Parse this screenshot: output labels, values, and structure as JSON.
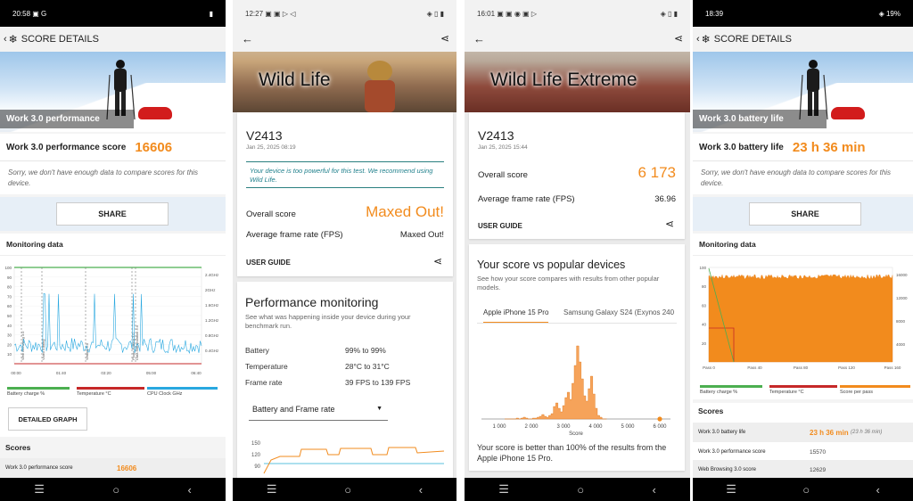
{
  "colors": {
    "accent": "#f28b1d",
    "green": "#4caf50",
    "red": "#c62828",
    "blue": "#29a8e0"
  },
  "panel1": {
    "status": {
      "time": "20:58",
      "icons": "▣ G",
      "battery": "▮"
    },
    "appbar_title": "SCORE DETAILS",
    "hero_label": "Work 3.0 performance",
    "score_label": "Work 3.0 performance score",
    "score_value": "16606",
    "note": "Sorry, we don't have enough data to compare scores for this device.",
    "share_label": "SHARE",
    "monitoring_title": "Monitoring data",
    "left_ticks": [
      "100",
      "90",
      "80",
      "70",
      "60",
      "50",
      "40",
      "30",
      "20",
      "10"
    ],
    "right_ticks": [
      "2.4GHz",
      "2GHz",
      "1.6GHz",
      "1.2GHz",
      "0.8GHz",
      "0.4GHz"
    ],
    "time_ticks": [
      "00:00",
      "01:40",
      "03:20",
      "05:00",
      "06:40"
    ],
    "markers": [
      "Web Browsing 3.0",
      "Video Editing",
      "Writing 3.0",
      "Photo Editing 3.0",
      "Data Manipulation 3.0"
    ],
    "legend": [
      {
        "label": "Battery charge %",
        "color": "#4caf50"
      },
      {
        "label": "Temperature °C",
        "color": "#c62828"
      },
      {
        "label": "CPU Clock GHz",
        "color": "#29a8e0"
      }
    ],
    "detailed_label": "DETAILED GRAPH",
    "scores_heading": "Scores",
    "rows": [
      {
        "label": "Work 3.0 performance score",
        "value": "16606"
      }
    ]
  },
  "panel2": {
    "status": {
      "time": "12:27",
      "icons": "▣ ▣ ▷ ◁",
      "right": "◈ ▯ ▮"
    },
    "banner_title": "Wild Life",
    "device": "V2413",
    "date": "Jan 25, 2025 08:19",
    "powerful_note": "Your device is too powerful for this test. We recommend using Wild Life.",
    "overall_label": "Overall score",
    "overall_value": "Maxed Out!",
    "fps_label": "Average frame rate (FPS)",
    "fps_value": "Maxed Out!",
    "guide_label": "USER GUIDE",
    "perf_title": "Performance monitoring",
    "perf_sub": "See what was happening inside your device during your benchmark run.",
    "perf_rows": [
      {
        "label": "Battery",
        "value": "99% to 99%"
      },
      {
        "label": "Temperature",
        "value": "28°C to 31°C"
      },
      {
        "label": "Frame rate",
        "value": "39 FPS to 139 FPS"
      }
    ],
    "dropdown": "Battery and Frame rate",
    "ticks": [
      "150",
      "120",
      "90"
    ]
  },
  "panel3": {
    "status": {
      "time": "16:01",
      "icons": "▣ ▣ ◉ ▣ ▷",
      "right": "◈ ▯ ▮"
    },
    "banner_title": "Wild Life Extreme",
    "device": "V2413",
    "date": "Jan 25, 2025 15:44",
    "overall_label": "Overall score",
    "overall_value": "6 173",
    "fps_label": "Average frame rate (FPS)",
    "fps_value": "36.96",
    "guide_label": "USER GUIDE",
    "vs_title": "Your score vs popular devices",
    "vs_sub": "See how your score compares with results from other popular models.",
    "tab1": "Apple iPhone 15 Pro",
    "tab2": "Samsung Galaxy S24 (Exynos 240",
    "x_ticks": [
      "1 000",
      "2 000",
      "3 000",
      "4 000",
      "5 000",
      "6 000"
    ],
    "x_label": "Score",
    "result": "Your score is better than 100% of the results from the Apple iPhone 15 Pro."
  },
  "panel4": {
    "status": {
      "time": "18:39",
      "right": "◈ 19%"
    },
    "appbar_title": "SCORE DETAILS",
    "hero_label": "Work 3.0 battery life",
    "score_label": "Work 3.0 battery life",
    "score_value": "23 h 36 min",
    "note": "Sorry, we don't have enough data to compare scores for this device.",
    "share_label": "SHARE",
    "monitoring_title": "Monitoring data",
    "left_ticks": [
      "100",
      "80",
      "60",
      "40",
      "20"
    ],
    "right_ticks": [
      "16000",
      "12000",
      "8000",
      "4000"
    ],
    "x_ticks": [
      "Pass 0",
      "Pass 40",
      "Pass 80",
      "Pass 120",
      "Pass 160"
    ],
    "legend": [
      {
        "label": "Battery charge %",
        "color": "#4caf50"
      },
      {
        "label": "Temperature °C",
        "color": "#c62828"
      },
      {
        "label": "Score per pass",
        "color": "#f28b1d"
      }
    ],
    "scores_heading": "Scores",
    "rows": [
      {
        "label": "Work 3.0 battery life",
        "value": "23 h 36 min",
        "extra": "(23 h 36 min)"
      },
      {
        "label": "Work 3.0 performance score",
        "value": "15570"
      },
      {
        "label": "Web Browsing 3.0 score",
        "value": "12629"
      }
    ]
  },
  "nav": {
    "menu": "☰",
    "home": "○",
    "back": "‹"
  }
}
